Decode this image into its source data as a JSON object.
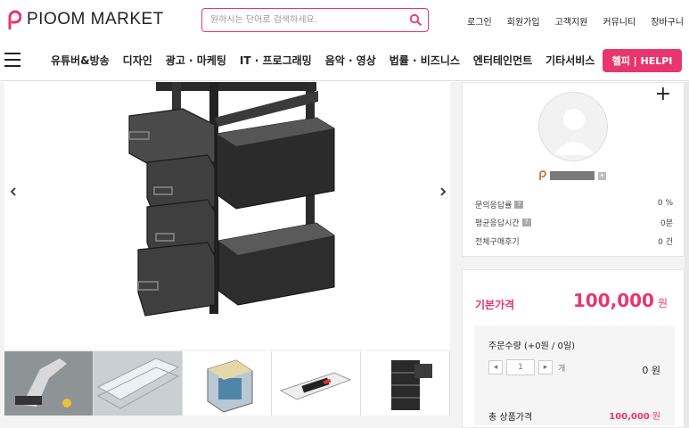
{
  "header": {
    "logo_text": "PIOOM MARKET",
    "search_placeholder": "원하시는 단어로 검색하세요.",
    "util_links": [
      "로그인",
      "회원가입",
      "고객지원",
      "커뮤니티",
      "장바구니"
    ]
  },
  "nav": {
    "items": [
      "유튜버&방송",
      "디자인",
      "광고 · 마케팅",
      "IT · 프로그래밍",
      "음악 · 영상",
      "법률 · 비즈니스",
      "엔터테인먼트",
      "기타서비스"
    ],
    "help_label": "헬피 | HELPI"
  },
  "seller": {
    "stats": [
      {
        "label": "문의응답률",
        "value": "0 %"
      },
      {
        "label": "평균응답시간",
        "value": "0분"
      },
      {
        "label": "전체구매후기",
        "value": "0 건"
      }
    ]
  },
  "price": {
    "label": "기본가격",
    "value": "100,000",
    "currency": "원",
    "order_title": "주문수량 (+0원 / 0일)",
    "quantity": "1",
    "quantity_unit": "개",
    "order_price": "0 원",
    "total_label": "총 상품가격",
    "total_value": "100,000",
    "total_currency": "원"
  },
  "colors": {
    "accent": "#e8356d"
  }
}
